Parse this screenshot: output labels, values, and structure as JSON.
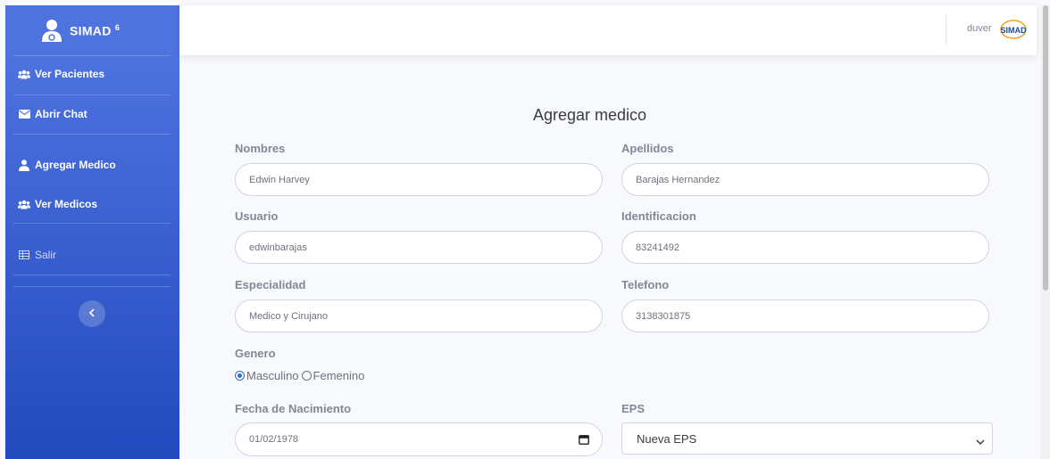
{
  "brand": {
    "name": "SIMAD",
    "sup": "6"
  },
  "sidebar": {
    "items": [
      {
        "label": "Ver Pacientes",
        "icon": "users-icon"
      },
      {
        "label": "Abrir Chat",
        "icon": "envelope-icon"
      },
      {
        "label": "Agregar Medico",
        "icon": "user-icon"
      },
      {
        "label": "Ver Medicos",
        "icon": "users-icon"
      },
      {
        "label": "Salir",
        "icon": "table-icon"
      }
    ],
    "toggle_icon": "chevron-left-icon"
  },
  "topbar": {
    "user": "duver",
    "logo_text": "SIMAD"
  },
  "form": {
    "title": "Agregar medico",
    "nombres": {
      "label": "Nombres",
      "value": "Edwin Harvey"
    },
    "apellidos": {
      "label": "Apellidos",
      "value": "Barajas Hernandez"
    },
    "usuario": {
      "label": "Usuario",
      "value": "edwinbarajas"
    },
    "identificacion": {
      "label": "Identificacion",
      "value": "83241492"
    },
    "especialidad": {
      "label": "Especialidad",
      "value": "Medico y Cirujano"
    },
    "telefono": {
      "label": "Telefono",
      "value": "3138301875"
    },
    "genero": {
      "label": "Genero",
      "options": [
        "Masculino",
        "Femenino"
      ],
      "selected": "Masculino"
    },
    "fecha": {
      "label": "Fecha de Nacimiento",
      "value": "01/02/1978"
    },
    "eps": {
      "label": "EPS",
      "value": "Nueva EPS"
    }
  },
  "colors": {
    "sidebar_top": "#4e73df",
    "sidebar_bottom": "#224abe",
    "accent": "#2f6bd8"
  }
}
